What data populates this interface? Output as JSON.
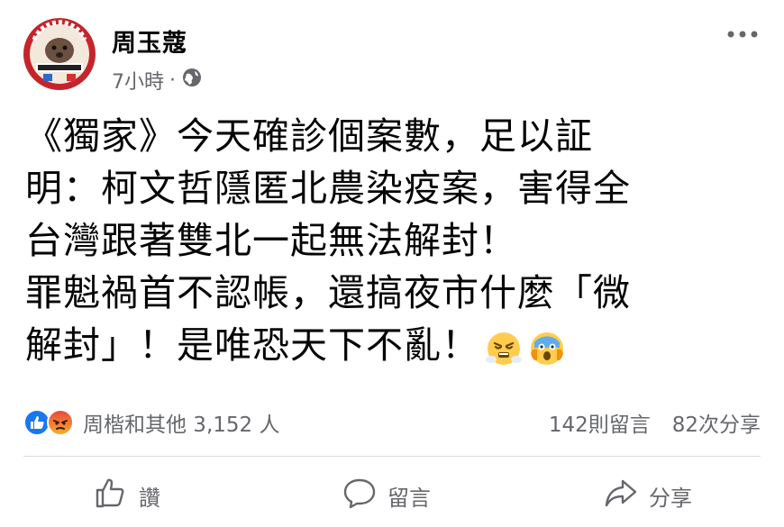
{
  "post": {
    "author": "周玉蔻",
    "timestamp": "7小時",
    "separator": "·",
    "privacy_icon": "globe-icon",
    "more_icon": "more-options-icon",
    "lines": [
      "《獨家》今天確診個案數，足以証",
      "明：柯文哲隱匿北農染疫案，害得全",
      "台灣跟著雙北一起無法解封！",
      "罪魁禍首不認帳，還搞夜市什麼「微",
      "解封」！是唯恐天下不亂！"
    ],
    "emojis": [
      "triumph-face-icon",
      "screaming-face-icon"
    ]
  },
  "engagement": {
    "reactions_text": "周楷和其他 3,152 人",
    "reaction_icons": [
      "like-icon",
      "angry-icon"
    ],
    "comments": "142則留言",
    "shares": "82次分享"
  },
  "actions": {
    "like": "讚",
    "comment": "留言",
    "share": "分享"
  },
  "colors": {
    "like_blue": "#1877f2",
    "angry_red": "#e8453c",
    "secondary_text": "#65676b"
  }
}
